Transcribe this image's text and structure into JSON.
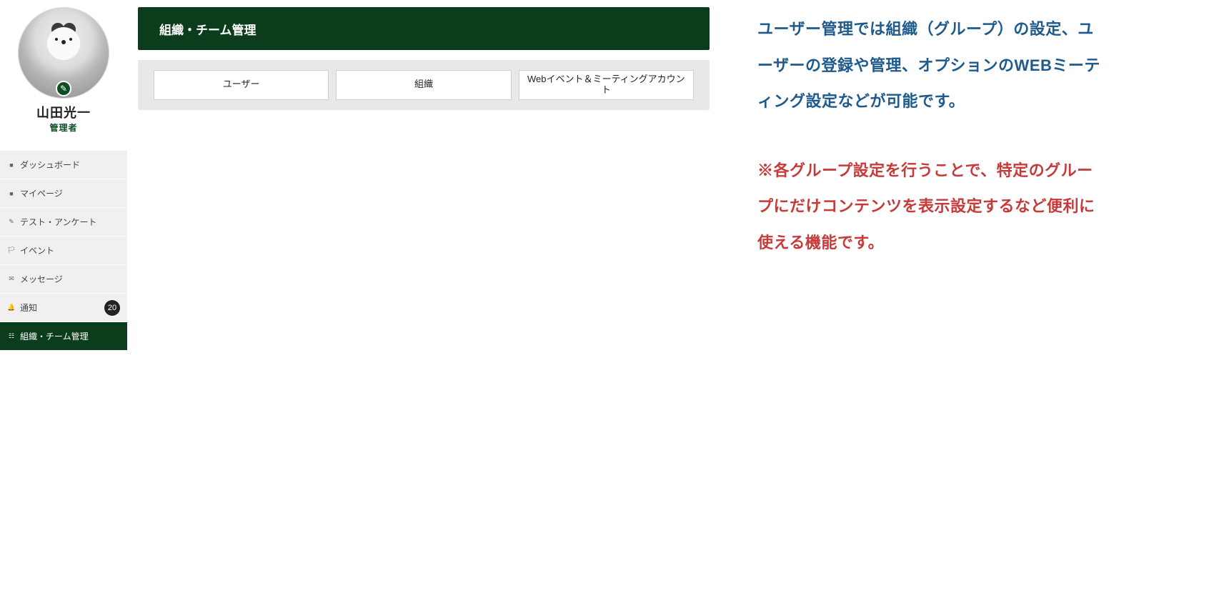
{
  "profile": {
    "name": "山田光一",
    "role": "管理者"
  },
  "nav": {
    "items": [
      {
        "label": "ダッシュボード",
        "glyph": "■"
      },
      {
        "label": "マイページ",
        "glyph": "■"
      },
      {
        "label": "テスト・アンケート",
        "glyph": "✎"
      },
      {
        "label": "イベント",
        "glyph": "🏳"
      },
      {
        "label": "メッセージ",
        "glyph": "✉"
      },
      {
        "label": "通知",
        "glyph": "🔔",
        "badge": "20"
      },
      {
        "label": "組織・チーム管理",
        "glyph": "☷",
        "active": true
      }
    ]
  },
  "header": {
    "title": "組織・チーム管理"
  },
  "tabs": [
    {
      "label": "ユーザー"
    },
    {
      "label": "組織"
    },
    {
      "label": "Webイベント＆ミーティングアカウント"
    }
  ],
  "notes": {
    "p1": "ユーザー管理では組織（グループ）の設定、ユーザーの登録や管理、オプションのWEBミーティング設定などが可能です。",
    "p2": "※各グループ設定を行うことで、特定のグループにだけコンテンツを表示設定するなど便利に使える機能です。"
  }
}
